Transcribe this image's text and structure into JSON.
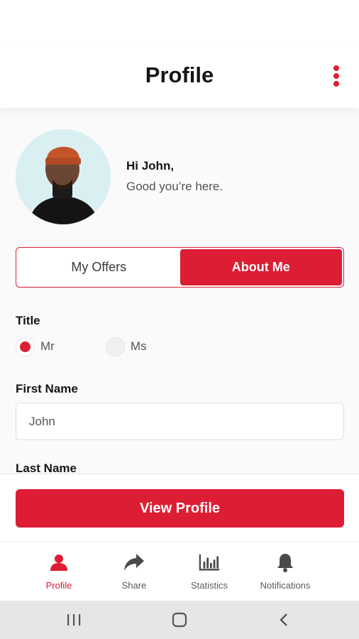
{
  "header": {
    "title": "Profile"
  },
  "profile": {
    "greeting": "Hi John,",
    "subtitle": "Good you’re here."
  },
  "segmented": {
    "tabs": [
      {
        "label": "My Offers",
        "active": false
      },
      {
        "label": "About Me",
        "active": true
      }
    ]
  },
  "form": {
    "title_label": "Title",
    "title_options": [
      {
        "label": "Mr",
        "checked": true
      },
      {
        "label": "Ms",
        "checked": false
      }
    ],
    "first_name_label": "First Name",
    "first_name_value": "John",
    "last_name_label": "Last Name"
  },
  "actions": {
    "view_profile_label": "View Profile"
  },
  "bottom_nav": {
    "items": [
      {
        "label": "Profile",
        "icon": "person-icon",
        "active": true
      },
      {
        "label": "Share",
        "icon": "share-arrow-icon",
        "active": false
      },
      {
        "label": "Statistics",
        "icon": "bar-chart-icon",
        "active": false
      },
      {
        "label": "Notifications",
        "icon": "bell-icon",
        "active": false
      }
    ]
  },
  "colors": {
    "accent": "#dd1d33",
    "text_dark": "#151515",
    "text_muted": "#555555",
    "system_nav_bg": "#e6e6e6"
  }
}
